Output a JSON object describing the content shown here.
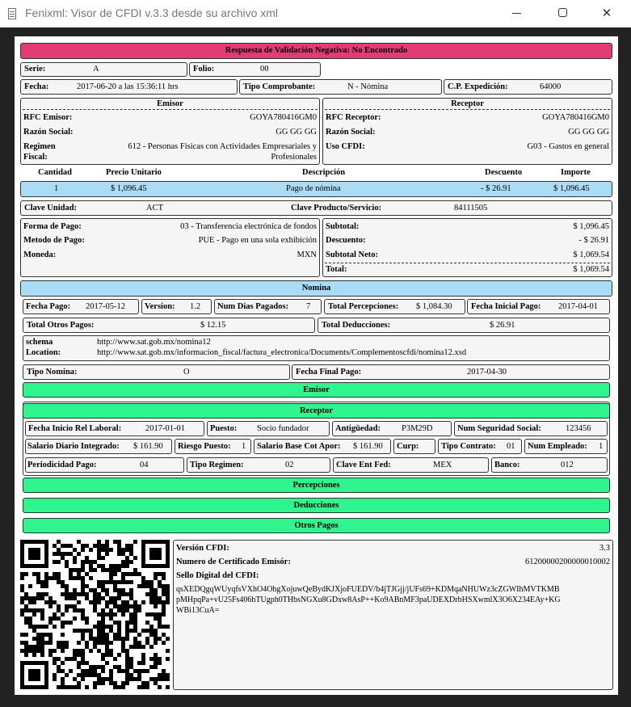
{
  "window": {
    "title": "Fenixml: Visor de CFDI v.3.3 desde su archivo xml",
    "minimize_glyph": "",
    "maximize_glyph": "",
    "close_glyph": "✕"
  },
  "validation": {
    "text": "Respuesta de Validación Negativa: No Encontrado",
    "color": "#e33c74"
  },
  "header": {
    "serie_label": "Serie:",
    "serie": "A",
    "folio_label": "Folio:",
    "folio": "00",
    "fecha_label": "Fecha:",
    "fecha": "2017-06-20 a las 15:36:11 hrs",
    "tipo_label": "Tipo Comprobante:",
    "tipo": "N - Nómina",
    "cp_label": "C.P. Expedición:",
    "cp": "64000"
  },
  "emisor": {
    "title": "Emisor",
    "rfc_label": "RFC Emisor:",
    "rfc": "GOYA780416GM0",
    "razon_label": "Razón Social:",
    "razon": "GG GG GG",
    "regimen_label_1": "Regimen",
    "regimen_label_2": "Fiscal:",
    "regimen_1": "612 - Personas Físicas con Actividades Empresariales y",
    "regimen_2": "Profesionales"
  },
  "receptor": {
    "title": "Receptor",
    "rfc_label": "RFC Receptor:",
    "rfc": "GOYA780416GM0",
    "razon_label": "Razón Social:",
    "razon": "GG GG GG",
    "uso_label": "Uso CFDI:",
    "uso": "G03 - Gastos en general"
  },
  "conceptos": {
    "headers": [
      "Cantidad",
      "Precio Unitario",
      "Descripción",
      "Descuento",
      "Importe"
    ],
    "row": {
      "cantidad": "1",
      "precio": "$ 1,096.45",
      "descripcion": "Pago de nómina",
      "descuento": "- $ 26.91",
      "importe": "$ 1,096.45"
    },
    "clave_unidad_label": "Clave Unidad:",
    "clave_unidad": "ACT",
    "clave_prod_label": "Clave Producto/Servicio:",
    "clave_prod": "84111505"
  },
  "pago": {
    "forma_label": "Forma de Pago:",
    "forma": "03 - Transferencia electrónica de fondos",
    "metodo_label": "Metodo de Pago:",
    "metodo": "PUE - Pago en una sola exhibición",
    "moneda_label": "Moneda:",
    "moneda": "MXN"
  },
  "totales": {
    "subtotal_label": "Subtotal:",
    "subtotal": "$ 1,096.45",
    "descuento_label": "Descuento:",
    "descuento": "- $ 26.91",
    "neto_label": "Subtotal Neto:",
    "neto": "$ 1,069.54",
    "total_label": "Total:",
    "total": "$ 1,069.54"
  },
  "nomina": {
    "title": "Nomina",
    "fecha_pago_label": "Fecha Pago:",
    "fecha_pago": "2017-05-12",
    "version_label": "Version:",
    "version": "1.2",
    "dias_label": "Num Dias Pagados:",
    "dias": "7",
    "percepciones_label": "Total Percepciones:",
    "percepciones": "$ 1,084.30",
    "fecha_ini_label": "Fecha Inicial Pago:",
    "fecha_ini": "2017-04-01",
    "otros_label": "Total Otros Pagos:",
    "otros": "$ 12.15",
    "deducciones_label": "Total Deducciones:",
    "deducciones": "$ 26.91",
    "schema_label": "schema",
    "schema": "http://www.sat.gob.mx/nomina12",
    "location_label": "Location:",
    "location": "http://www.sat.gob.mx/informacion_fiscal/factura_electronica/Documents/Complementoscfdi/nomina12.xsd",
    "tipo_label": "Tipo Nomina:",
    "tipo": "O",
    "fecha_fin_label": "Fecha Final Pago:",
    "fecha_fin": "2017-04-30",
    "emisor_title": "Emisor",
    "receptor_title": "Receptor",
    "percepciones_title": "Percepciones",
    "deducciones_title": "Deducciones",
    "otros_title": "Otros Pagos"
  },
  "nom_receptor": {
    "inicio_label": "Fecha Inicio Rel Laboral:",
    "inicio": "2017-01-01",
    "puesto_label": "Puesto:",
    "puesto": "Socio fundador",
    "antig_label": "Antigüedad:",
    "antig": "P3M29D",
    "nss_label": "Num Seguridad Social:",
    "nss": "123456",
    "sdi_label": "Salario Diario Integrado:",
    "sdi": "$ 161.90",
    "riesgo_label": "Riesgo Puesto:",
    "riesgo": "1",
    "sbc_label": "Salario Base Cot Apor:",
    "sbc": "$ 161.90",
    "curp_label": "Curp:",
    "curp": "",
    "contrato_label": "Tipo Contrato:",
    "contrato": "01",
    "empleado_label": "Num Empleado:",
    "empleado": "1",
    "periodicidad_label": "Periodicidad Pago:",
    "periodicidad": "04",
    "regimen_label": "Tipo Regimen:",
    "regimen": "02",
    "entfed_label": "Clave Ent Fed:",
    "entfed": "MEX",
    "banco_label": "Banco:",
    "banco": "012"
  },
  "sello": {
    "version_label": "Versión CFDI:",
    "version": "3.3",
    "cert_label": "Numero de Certificado Emisór:",
    "cert": "61200000200000010002",
    "sello_label": "Sello Digital del CFDI:",
    "sello_1": "qsXEDQgqWUyqfsVXhO4OhgXojuwQeBydKJXjoFUEDV/b4jTJGjj/jUFs69+KDMqaNHUWz3cZGWIhMVTKMB",
    "sello_2": "pMHpqPa+vU25Fs406hTUgph0THbsNGXu8GDxw8AsP++Ko9ABnMF3paUDEXDrbHSXwmlX3O6X234EAy+KG",
    "sello_3": "WBi13CuA="
  },
  "icons": {
    "app": "document-icon",
    "qr": "qr-code-icon"
  }
}
